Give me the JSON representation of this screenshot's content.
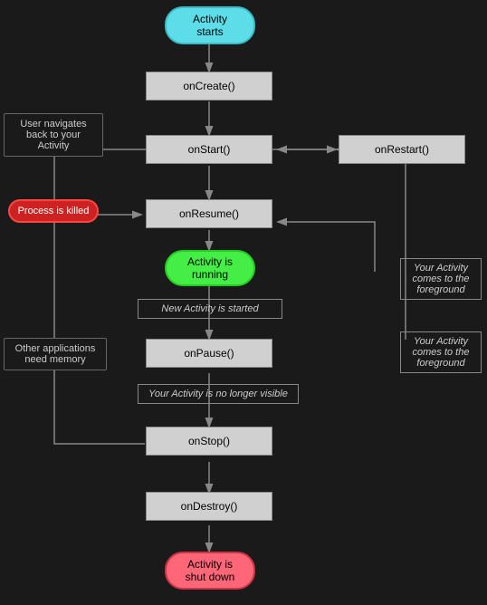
{
  "nodes": {
    "activityStarts": {
      "label": "Activity\nstarts"
    },
    "onCreate": {
      "label": "onCreate()"
    },
    "onStart": {
      "label": "onStart()"
    },
    "onRestart": {
      "label": "onRestart()"
    },
    "onResume": {
      "label": "onResume()"
    },
    "activityRunning": {
      "label": "Activity is\nrunning"
    },
    "onPause": {
      "label": "onPause()"
    },
    "onStop": {
      "label": "onStop()"
    },
    "onDestroy": {
      "label": "onDestroy()"
    },
    "activityShutDown": {
      "label": "Activity is\nshut down"
    }
  },
  "sideLabels": {
    "userNavigates": {
      "label": "User navigates\nback to your\nActivity"
    },
    "processKilled": {
      "label": "Process is\nkilled"
    },
    "otherApps": {
      "label": "Other applications\nneed memory"
    },
    "newActivityStarted": {
      "label": "New Activity is started"
    },
    "yourActivityForeground1": {
      "label": "Your Activity\ncomes to the\nforeground"
    },
    "yourActivityForeground2": {
      "label": "Your Activity\ncomes to the\nforeground"
    },
    "noLongerVisible": {
      "label": "Your Activity is no longer visible"
    }
  },
  "colors": {
    "bg": "#1a1a1a",
    "rect": "#d0d0d0",
    "cyan": "#5ddde8",
    "green": "#44ee44",
    "red": "#ff4444",
    "pink": "#ff6677"
  }
}
